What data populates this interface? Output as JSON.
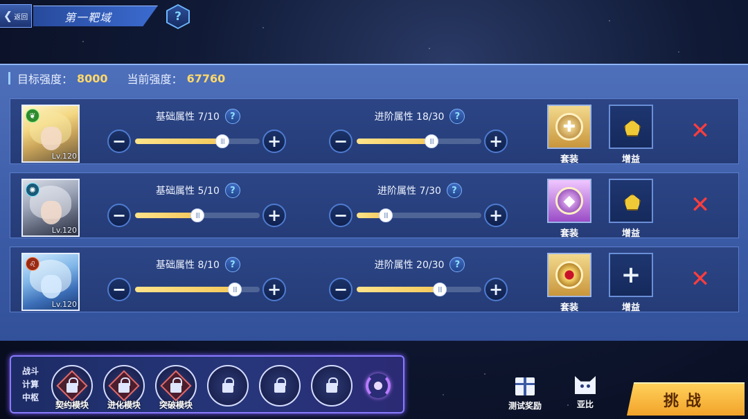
{
  "header": {
    "back_label": "返回",
    "title": "第一靶域",
    "help_symbol": "?"
  },
  "strength": {
    "target_label": "目标强度：",
    "target_value": "8000",
    "current_label": "当前强度：",
    "current_value": "67760"
  },
  "rows": [
    {
      "level": "Lv.120",
      "base": {
        "label": "基础属性 7/10",
        "value": 7,
        "max": 10
      },
      "adv": {
        "label": "进阶属性 18/30",
        "value": 18,
        "max": 30
      },
      "suit_label": "套装",
      "buff_label": "增益",
      "buff_state": "gem"
    },
    {
      "level": "Lv.120",
      "base": {
        "label": "基础属性 5/10",
        "value": 5,
        "max": 10
      },
      "adv": {
        "label": "进阶属性 7/30",
        "value": 7,
        "max": 30
      },
      "suit_label": "套装",
      "buff_label": "增益",
      "buff_state": "gem"
    },
    {
      "level": "Lv.120",
      "base": {
        "label": "基础属性 8/10",
        "value": 8,
        "max": 10
      },
      "adv": {
        "label": "进阶属性 20/30",
        "value": 20,
        "max": 30
      },
      "suit_label": "套装",
      "buff_label": "增益",
      "buff_state": "empty"
    }
  ],
  "controls": {
    "minus": "−",
    "plus": "+",
    "remove": "✕",
    "add": "+"
  },
  "hub": {
    "title": [
      "战斗",
      "计算",
      "中枢"
    ],
    "modules": [
      {
        "label": "契约模块",
        "state": "unlocked"
      },
      {
        "label": "进化模块",
        "state": "unlocked"
      },
      {
        "label": "突破模块",
        "state": "unlocked"
      },
      {
        "label": "",
        "state": "locked"
      },
      {
        "label": "",
        "state": "locked"
      },
      {
        "label": "",
        "state": "locked"
      }
    ]
  },
  "bottom": {
    "reward_label": "测试奖励",
    "yabi_label": "亚比",
    "challenge_label": "挑战"
  },
  "colors": {
    "accent_gold": "#ffd86b",
    "remove_red": "#ff3d3d",
    "panel_blue": "#3c5ba6"
  }
}
